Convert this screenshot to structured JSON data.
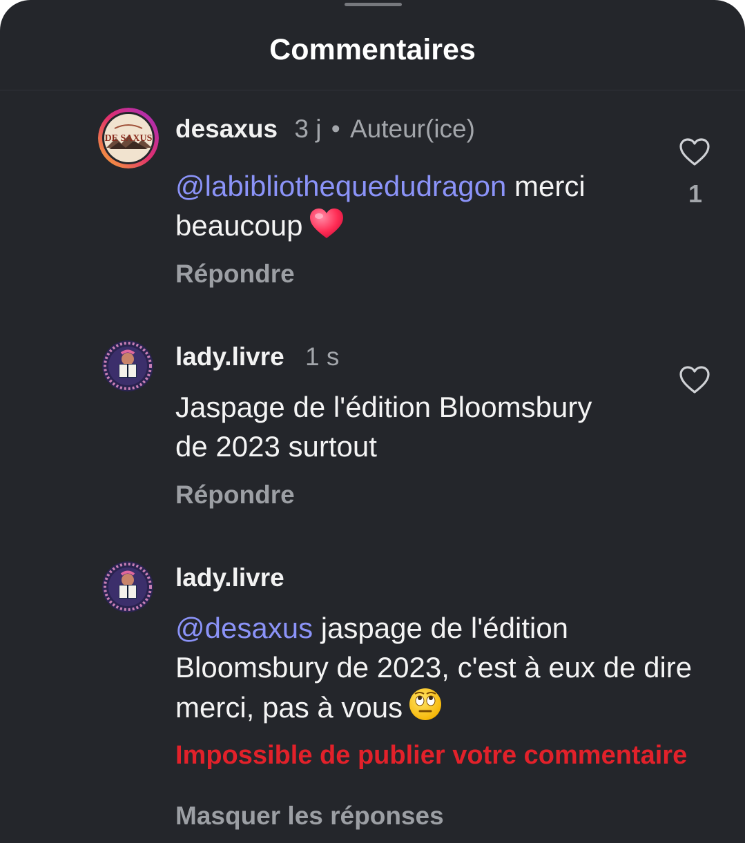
{
  "header": {
    "title": "Commentaires"
  },
  "colors": {
    "background": "#24262b",
    "mention": "#8b93f8",
    "error": "#e2212a",
    "muted": "#9c9fa4"
  },
  "comments": [
    {
      "username": "desaxus",
      "time": "3 j",
      "separator": "•",
      "badge": "Auteur(ice)",
      "avatar_text": "DE SAXUS",
      "mention": "@labibliothequedudragon",
      "text": " merci beaucoup",
      "emoji": "heart-emoji",
      "reply_label": "Répondre",
      "likes": "1",
      "like_icon": "heart-outline-icon"
    },
    {
      "username": "lady.livre",
      "time": "1 s",
      "text": "Jaspage de l'édition Bloomsbury de 2023 surtout",
      "reply_label": "Répondre",
      "like_icon": "heart-outline-icon"
    },
    {
      "username": "lady.livre",
      "mention": "@desaxus",
      "text": " jaspage de l'édition Bloomsbury de 2023, c'est à eux de dire merci, pas à vous",
      "emoji": "eye-roll-emoji",
      "error": "Impossible de publier votre commentaire"
    }
  ],
  "footer": {
    "hide_replies": "Masquer les réponses"
  }
}
